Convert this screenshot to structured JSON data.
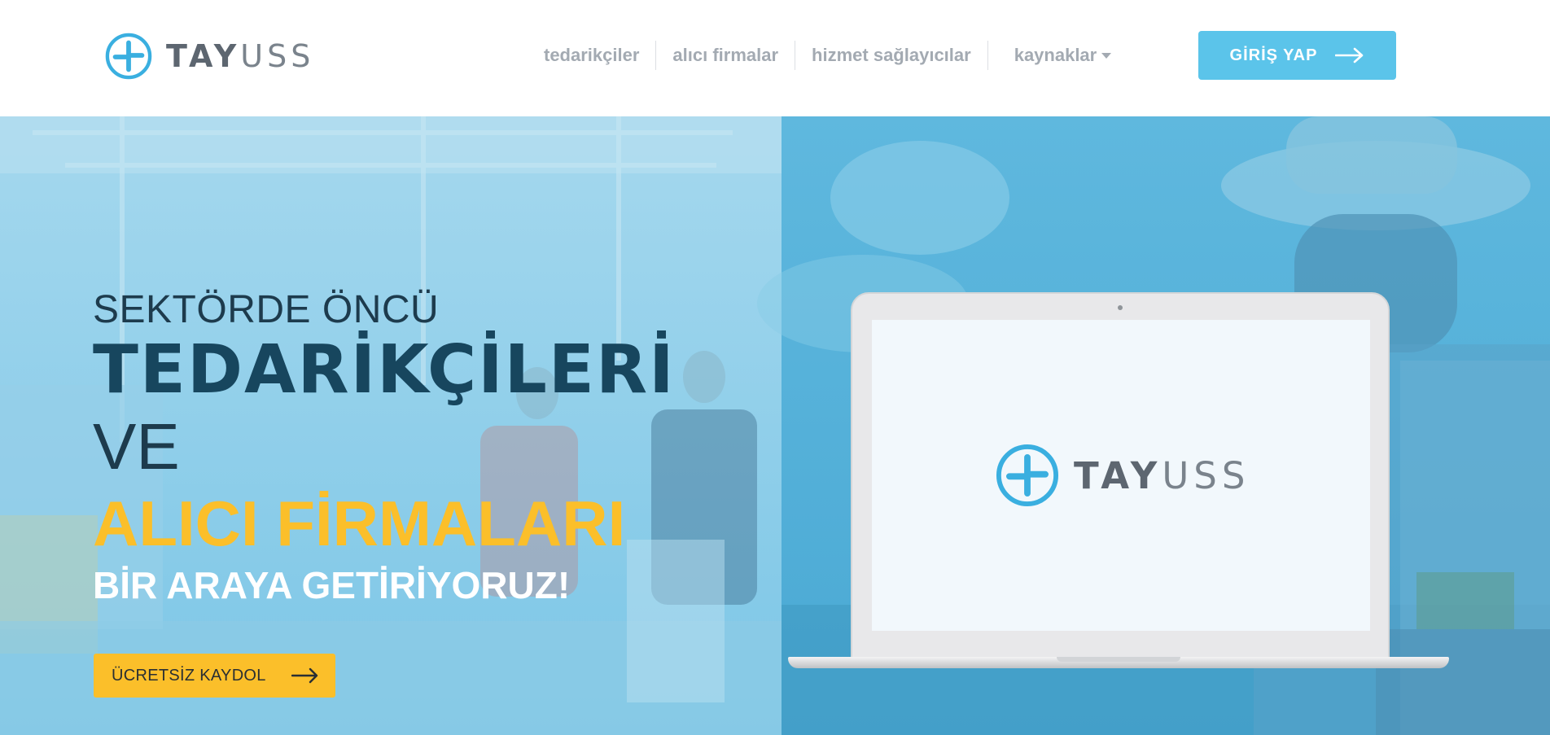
{
  "brand": {
    "logo_icon": "tayuss-cross-logo-icon",
    "name_bold": "TAY",
    "name_light": "USS",
    "accent": "#5bc4ea"
  },
  "nav": {
    "items": [
      {
        "label": "tedarikçiler"
      },
      {
        "label": "alıcı firmalar"
      },
      {
        "label": "hizmet sağlayıcılar"
      },
      {
        "label": "kaynaklar"
      }
    ],
    "dropdown_icon": "caret-down-icon"
  },
  "login_button": {
    "label": "GİRİŞ YAP",
    "icon": "arrow-right-icon",
    "color": "#5bc4ea"
  },
  "hero": {
    "line1": "SEKTÖRDE ÖNCÜ",
    "line2": "TEDARİKÇİLERİ",
    "line3": "VE",
    "line4": "ALICI FİRMALARI",
    "line5": "BİR ARAYA GETİRİYORUZ!",
    "highlight_color": "#fbbf2a",
    "signup_button": {
      "label": "ÜCRETSİZ KAYDOL",
      "icon": "arrow-right-icon",
      "color": "#fbbf2a"
    },
    "laptop_screen": {
      "name_bold": "TAY",
      "name_light": "USS"
    }
  }
}
